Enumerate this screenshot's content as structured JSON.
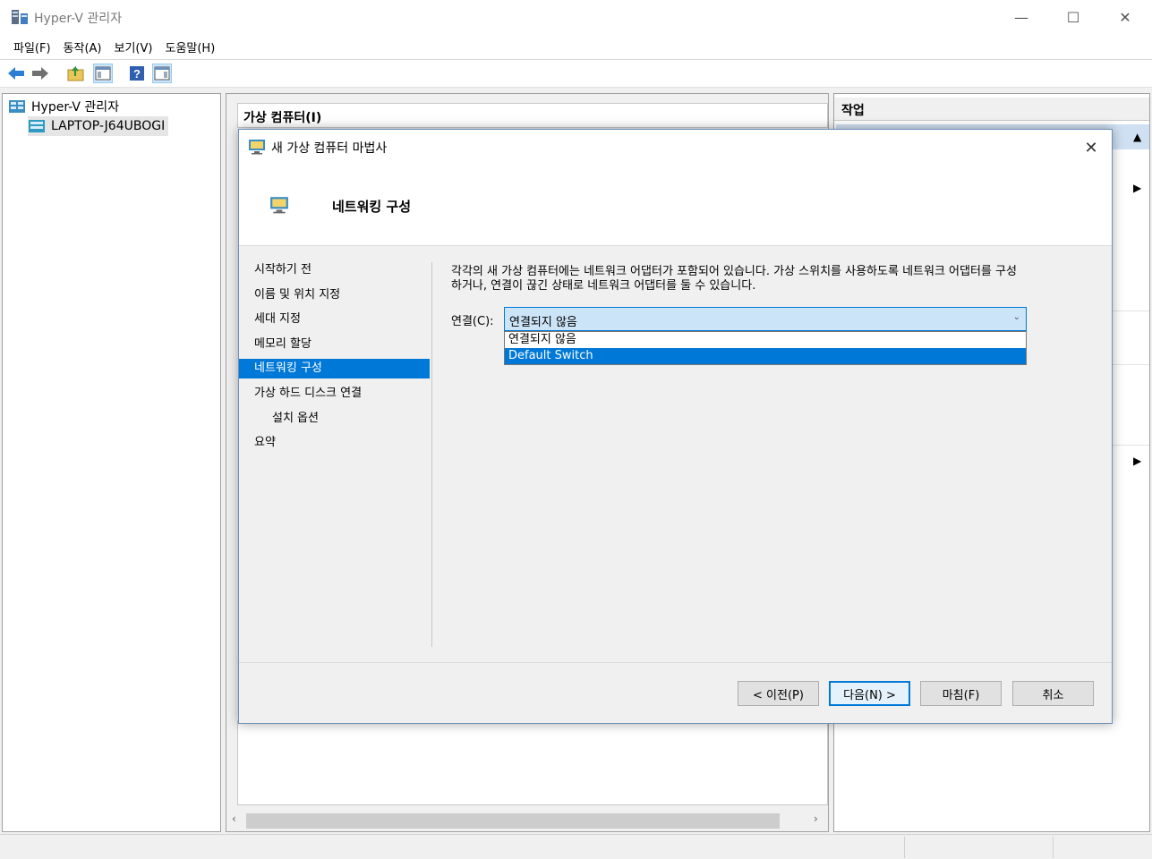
{
  "window": {
    "title": "Hyper-V 관리자",
    "controls": {
      "minimize": "—",
      "maximize": "☐",
      "close": "✕"
    }
  },
  "menu": {
    "items": [
      {
        "label": "파일(F)"
      },
      {
        "label": "동작(A)"
      },
      {
        "label": "보기(V)"
      },
      {
        "label": "도움말(H)"
      }
    ]
  },
  "toolbar": {
    "buttons": [
      "back-arrow-icon",
      "forward-arrow-icon",
      "up-folder-icon",
      "show-hide-console-tree-icon",
      "help-icon",
      "show-hide-action-pane-icon"
    ]
  },
  "tree": {
    "root": "Hyper-V 관리자",
    "child": "LAPTOP-J64UBOGI"
  },
  "center": {
    "header": "가상 컴퓨터(I)"
  },
  "actions": {
    "header": "작업"
  },
  "dialog": {
    "title": "새 가상 컴퓨터 마법사",
    "close": "✕",
    "page_title": "네트워킹 구성",
    "nav": [
      {
        "label": "시작하기 전",
        "sub": false,
        "active": false
      },
      {
        "label": "이름 및 위치 지정",
        "sub": false,
        "active": false
      },
      {
        "label": "세대 지정",
        "sub": false,
        "active": false
      },
      {
        "label": "메모리 할당",
        "sub": false,
        "active": false
      },
      {
        "label": "네트워킹 구성",
        "sub": false,
        "active": true
      },
      {
        "label": "가상 하드 디스크 연결",
        "sub": false,
        "active": false
      },
      {
        "label": "설치 옵션",
        "sub": true,
        "active": false
      },
      {
        "label": "요약",
        "sub": false,
        "active": false
      }
    ],
    "description_line1": "각각의 새 가상 컴퓨터에는 네트워크 어댑터가 포함되어 있습니다. 가상 스위치를 사용하도록 네트워크 어댑터를 구성",
    "description_line2": "하거나, 연결이 끊긴 상태로 네트워크 어댑터를 둘 수 있습니다.",
    "connection_label": "연결(C):",
    "connection_value": "연결되지 않음",
    "connection_options": [
      {
        "label": "연결되지 않음",
        "highlighted": false
      },
      {
        "label": "Default Switch",
        "highlighted": true
      }
    ],
    "buttons": {
      "previous": "< 이전(P)",
      "next": "다음(N) >",
      "finish": "마침(F)",
      "cancel": "취소"
    }
  },
  "colors": {
    "accent": "#0078d7",
    "selection_highlight": "#0078d7",
    "combo_bg": "#cce4f7",
    "action_group_bg": "#cfe0f2"
  }
}
